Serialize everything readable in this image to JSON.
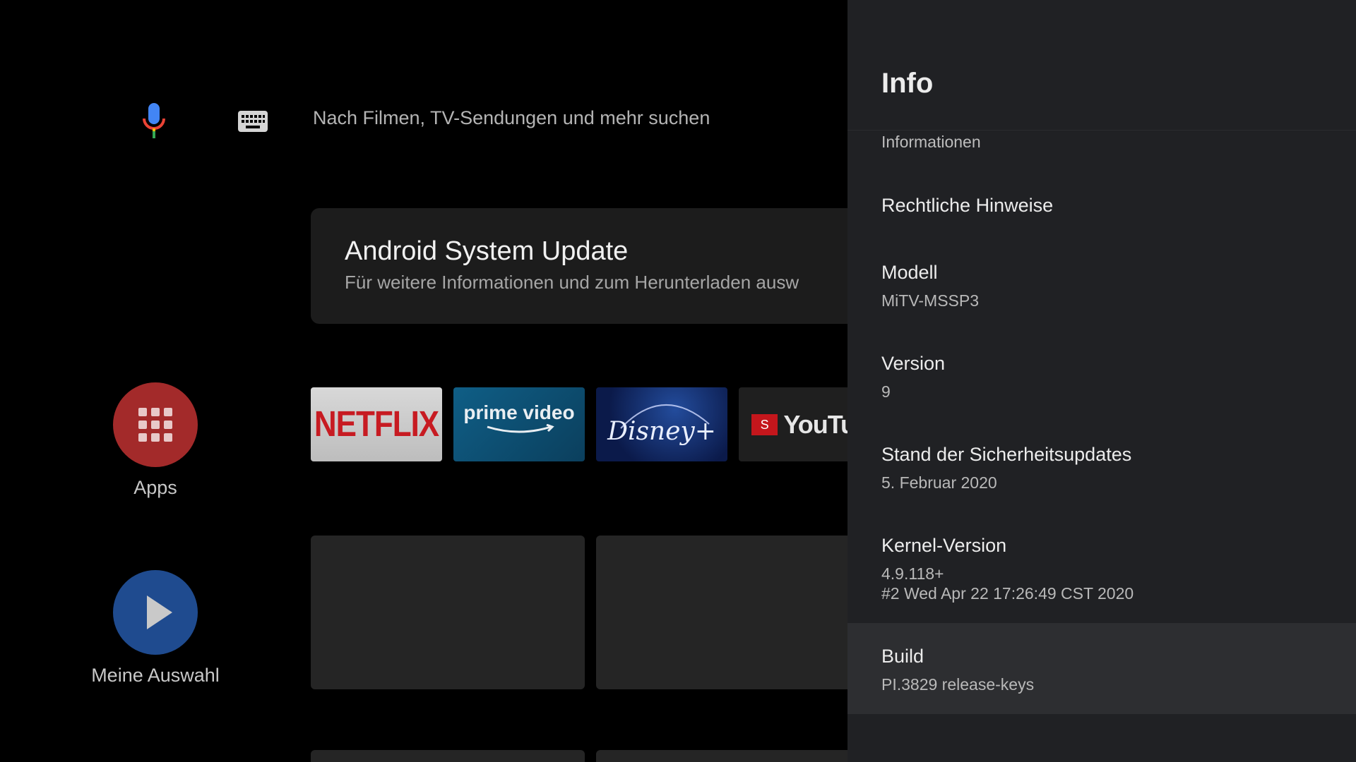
{
  "search": {
    "placeholder": "Nach Filmen, TV-Sendungen und mehr suchen",
    "mic_icon": "mic-icon",
    "keyboard_icon": "keyboard-icon"
  },
  "update_card": {
    "title": "Android System Update",
    "subtitle": "Für weitere Informationen und zum Herunterladen ausw"
  },
  "rail": [
    {
      "label": "Apps",
      "icon": "apps-grid-icon",
      "color": "#a32a2a"
    },
    {
      "label": "Meine Auswahl",
      "icon": "play-icon",
      "color": "#1f4b8f"
    }
  ],
  "apps": [
    {
      "name": "Netflix",
      "logo_text": "NETFLIX"
    },
    {
      "name": "Prime Video",
      "logo_text": "prime video"
    },
    {
      "name": "Disney+",
      "logo_text": "Disney+"
    },
    {
      "name": "YouTube",
      "logo_text": "YouTub",
      "badge": "S"
    }
  ],
  "panel": {
    "title": "Info",
    "partial_item": "Informationen",
    "items": [
      {
        "title": "Rechtliche Hinweise",
        "subtitle": ""
      },
      {
        "title": "Modell",
        "subtitle": "MiTV-MSSP3"
      },
      {
        "title": "Version",
        "subtitle": "9"
      },
      {
        "title": "Stand der Sicherheitsupdates",
        "subtitle": "5. Februar 2020"
      },
      {
        "title": "Kernel-Version",
        "subtitle": "4.9.118+",
        "subtitle2": "#2 Wed Apr 22 17:26:49 CST 2020"
      },
      {
        "title": "Build",
        "subtitle": "PI.3829 release-keys",
        "focused": true
      }
    ]
  },
  "colors": {
    "panel_bg": "#202124",
    "focused_row": "#2d2e31",
    "netflix_red": "#c71b22"
  }
}
